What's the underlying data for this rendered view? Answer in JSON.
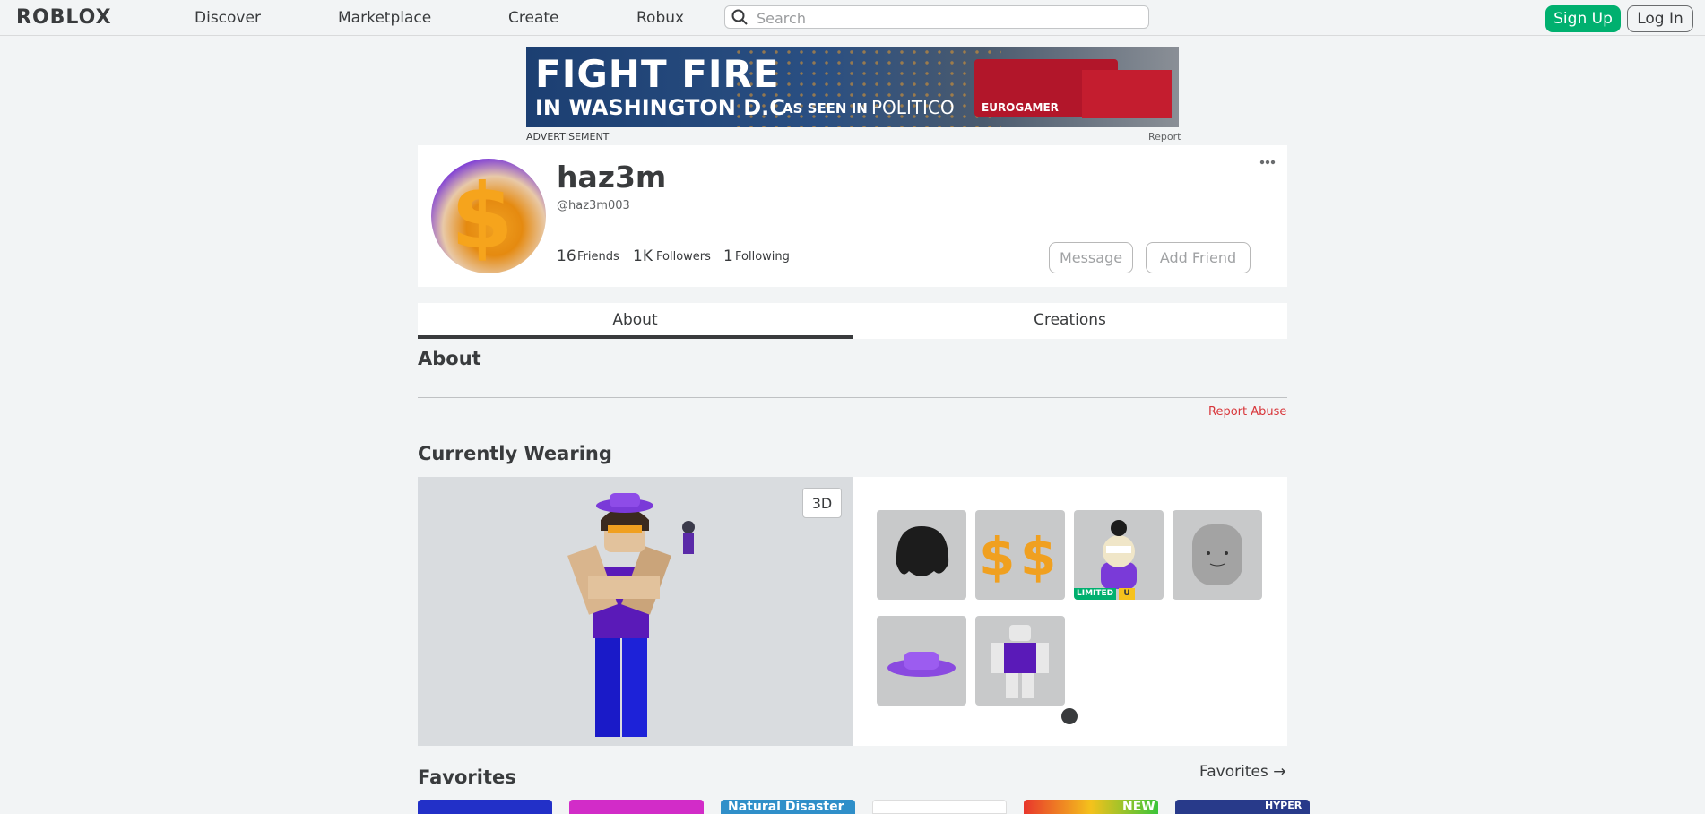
{
  "header": {
    "logo": "ROBLOX",
    "nav": [
      "Discover",
      "Marketplace",
      "Create",
      "Robux"
    ],
    "search_placeholder": "Search",
    "signup_label": "Sign Up",
    "login_label": "Log In"
  },
  "ad": {
    "headline": "FIGHT FIRE",
    "subline": "IN WASHINGTON D.C",
    "seen_in": "AS SEEN IN",
    "politico": "POLITICO",
    "eurogamer": "EUROGAMER",
    "label": "ADVERTISEMENT",
    "report": "Report"
  },
  "profile": {
    "display_name": "haz3m",
    "username": "@haz3m003",
    "friends_count": "16",
    "friends_label": "Friends",
    "followers_count": "1K",
    "followers_label": "Followers",
    "following_count": "1",
    "following_label": "Following",
    "message_label": "Message",
    "add_friend_label": "Add Friend"
  },
  "tabs": [
    "About",
    "Creations"
  ],
  "about": {
    "title": "About",
    "report_abuse": "Report Abuse"
  },
  "wearing": {
    "title": "Currently Wearing",
    "view_toggle": "3D",
    "items": [
      {
        "name": "hair-item-icon"
      },
      {
        "name": "dollar-sign-item-icon"
      },
      {
        "name": "cat-bear-item-icon",
        "badge": "LIMITED",
        "badge_extra": "U"
      },
      {
        "name": "head-item-icon"
      },
      {
        "name": "purple-hat-item-icon"
      },
      {
        "name": "purple-shirt-item-icon"
      }
    ]
  },
  "favorites": {
    "title": "Favorites",
    "link": "Favorites →",
    "thumbs": [
      {
        "label": "",
        "color": "#2230c8"
      },
      {
        "label": "",
        "color": "#d22cc8"
      },
      {
        "label": "Natural Disaster",
        "color": "#2f8fc9"
      },
      {
        "label": "",
        "color": "#ffffff"
      },
      {
        "label": "NEW",
        "color": "#e8362c"
      },
      {
        "label": "HYPER",
        "color": "#283a8a"
      }
    ]
  },
  "colors": {
    "accent_green": "#00b06f",
    "report_red": "#d8363a",
    "page_bg": "#f2f4f5"
  }
}
